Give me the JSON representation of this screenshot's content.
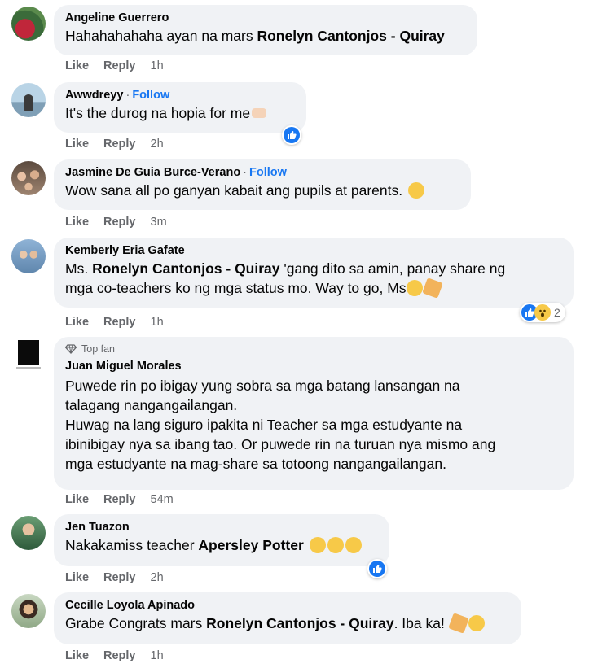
{
  "actions": {
    "like": "Like",
    "reply": "Reply"
  },
  "comments": [
    {
      "author": "Angeline Guerrero",
      "text_pre": "Hahahahahaha ayan na mars ",
      "mention": "Ronelyn Cantonjos - Quiray",
      "text_post": "",
      "time": "1h"
    },
    {
      "author": "Awwdreyy",
      "follow": "Follow",
      "text": "It's the durog na hopia for me",
      "time": "2h"
    },
    {
      "author": "Jasmine De Guia Burce-Verano",
      "follow": "Follow",
      "text": "Wow sana all po ganyan kabait ang pupils at parents.",
      "time": "3m"
    },
    {
      "author": "Kemberly Eria Gafate",
      "text_pre": "Ms. ",
      "mention": "Ronelyn Cantonjos - Quiray",
      "text_post": " 'gang dito sa amin, panay share ng",
      "text_line2": "mga co-teachers ko ng mga status mo. Way to go, Ms",
      "reaction_count": "2",
      "time": "1h"
    },
    {
      "badge": "Top fan",
      "author": "Juan Miguel Morales",
      "line1": "Puwede rin po ibigay yung sobra sa mga batang lansangan na",
      "line2": "talagang nangangailangan.",
      "line3": "Huwag na lang siguro ipakita ni Teacher sa mga estudyante na",
      "line4": "ibinibigay nya sa ibang tao. Or puwede rin na turuan nya mismo ang",
      "line5": "mga estudyante na mag-share sa totoong nangangailangan.",
      "time": "54m"
    },
    {
      "author": "Jen Tuazon",
      "text_pre": "Nakakamiss teacher ",
      "mention": "Apersley Potter",
      "time": "2h"
    },
    {
      "author": "Cecille Loyola Apinado",
      "text_pre": "Grabe Congrats mars ",
      "mention": "Ronelyn Cantonjos - Quiray",
      "text_post": ". Iba ka!",
      "time": "1h"
    }
  ],
  "colors": {
    "bubble": "#f0f2f5",
    "link": "#1877f2",
    "meta": "#65676b"
  }
}
